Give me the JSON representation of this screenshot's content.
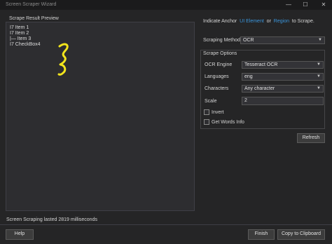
{
  "window": {
    "title": "Screen Scraper Wizard",
    "minimize_glyph": "—",
    "maximize_glyph": "☐",
    "close_glyph": "✕"
  },
  "preview": {
    "label": "Scrape Result Preview",
    "lines": [
      "I7 Item 1",
      "I7 Item 2",
      "|— Item 3",
      "I7 CheckBox4"
    ],
    "annotation_color": "#f2e41c"
  },
  "anchor": {
    "prefix": "Indicate Anchor",
    "ui_element_link": "UI Element",
    "or_text": "or",
    "region_link": "Region",
    "suffix": "to Scrape."
  },
  "scraping_method": {
    "label": "Scraping Method",
    "value": "OCR"
  },
  "scrape_options": {
    "title": "Scrape Options",
    "ocr_engine": {
      "label": "OCR Engine",
      "value": "Tesseract OCR"
    },
    "languages": {
      "label": "Languages",
      "value": "eng"
    },
    "characters": {
      "label": "Characters",
      "value": "Any character"
    },
    "scale": {
      "label": "Scale",
      "value": "2"
    },
    "invert": {
      "label": "Invert",
      "checked": false
    },
    "get_words_info": {
      "label": "Get Words Info",
      "checked": false
    }
  },
  "buttons": {
    "refresh": "Refresh",
    "help": "Help",
    "finish": "Finish",
    "copy_to_clipboard": "Copy to Clipboard"
  },
  "status": {
    "text": "Screen Scraping lasted 2819 milliseconds"
  },
  "icons": {
    "dropdown": "chevron-down-icon"
  },
  "colors": {
    "background": "#252526",
    "link": "#3a96dd",
    "annotation": "#f2e41c"
  }
}
